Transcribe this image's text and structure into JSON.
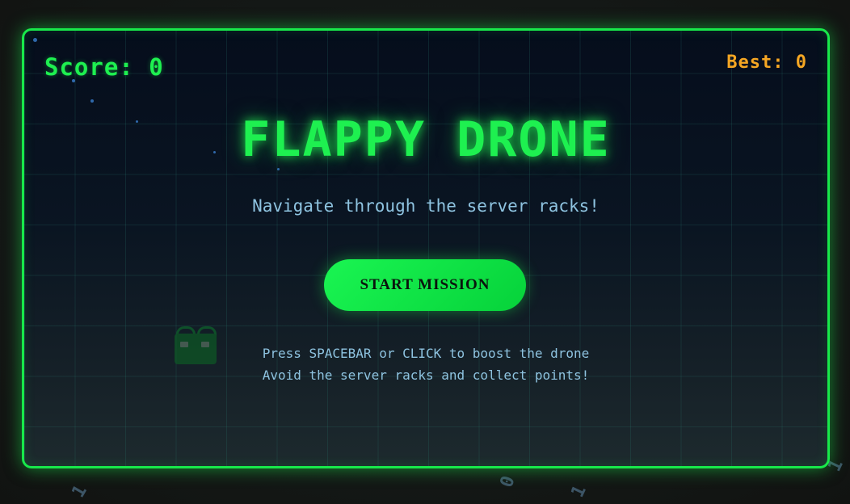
{
  "game": {
    "title": "FLAPPY DRONE",
    "subtitle": "Navigate through the server racks!",
    "start_label": "START MISSION",
    "instructions": [
      "Press SPACEBAR or CLICK to boost the drone",
      "Avoid the server racks and collect points!"
    ]
  },
  "hud": {
    "score_text": "Score: 0",
    "best_text": "Best: 0"
  },
  "background_digits": [
    "1",
    "0",
    "1",
    "1"
  ],
  "colors": {
    "accent": "#18e84a",
    "best": "#f5a623",
    "text_secondary": "#8ec3e0",
    "background": "#141816"
  },
  "icons": {
    "player": "drone-icon"
  }
}
